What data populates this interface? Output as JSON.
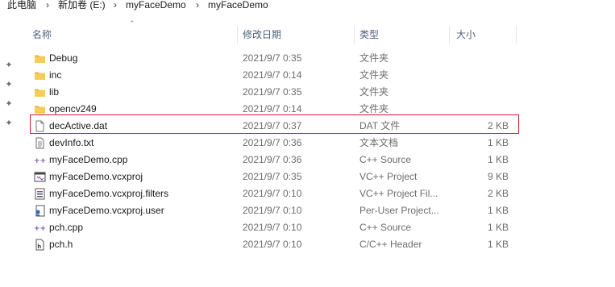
{
  "breadcrumb": [
    "此电脑",
    "新加卷 (E:)",
    "myFaceDemo",
    "myFaceDemo"
  ],
  "columns": {
    "name": "名称",
    "date": "修改日期",
    "type": "类型",
    "size": "大小"
  },
  "files": [
    {
      "name": "Debug",
      "date": "2021/9/7 0:35",
      "type": "文件夹",
      "size": "",
      "icon": "folder-icon"
    },
    {
      "name": "inc",
      "date": "2021/9/7 0:14",
      "type": "文件夹",
      "size": "",
      "icon": "folder-icon"
    },
    {
      "name": "lib",
      "date": "2021/9/7 0:35",
      "type": "文件夹",
      "size": "",
      "icon": "folder-icon"
    },
    {
      "name": "opencv249",
      "date": "2021/9/7 0:14",
      "type": "文件夹",
      "size": "",
      "icon": "folder-icon"
    },
    {
      "name": "decActive.dat",
      "date": "2021/9/7 0:37",
      "type": "DAT 文件",
      "size": "2 KB",
      "icon": "blank-file-icon"
    },
    {
      "name": "devInfo.txt",
      "date": "2021/9/7 0:36",
      "type": "文本文档",
      "size": "1 KB",
      "icon": "text-file-icon"
    },
    {
      "name": "myFaceDemo.cpp",
      "date": "2021/9/7 0:36",
      "type": "C++ Source",
      "size": "1 KB",
      "icon": "cpp-file-icon"
    },
    {
      "name": "myFaceDemo.vcxproj",
      "date": "2021/9/7 0:35",
      "type": "VC++ Project",
      "size": "9 KB",
      "icon": "vcxproj-icon"
    },
    {
      "name": "myFaceDemo.vcxproj.filters",
      "date": "2021/9/7 0:10",
      "type": "VC++ Project Fil...",
      "size": "2 KB",
      "icon": "filters-file-icon"
    },
    {
      "name": "myFaceDemo.vcxproj.user",
      "date": "2021/9/7 0:10",
      "type": "Per-User Project...",
      "size": "1 KB",
      "icon": "user-project-icon"
    },
    {
      "name": "pch.cpp",
      "date": "2021/9/7 0:10",
      "type": "C++ Source",
      "size": "1 KB",
      "icon": "cpp-file-icon"
    },
    {
      "name": "pch.h",
      "date": "2021/9/7 0:10",
      "type": "C/C++ Header",
      "size": "1 KB",
      "icon": "header-file-icon"
    }
  ],
  "highlighted_file": "decActive.dat",
  "colors": {
    "highlight_border": "#d0202a",
    "folder": "#f3c44f",
    "header_text": "#4c607a"
  }
}
